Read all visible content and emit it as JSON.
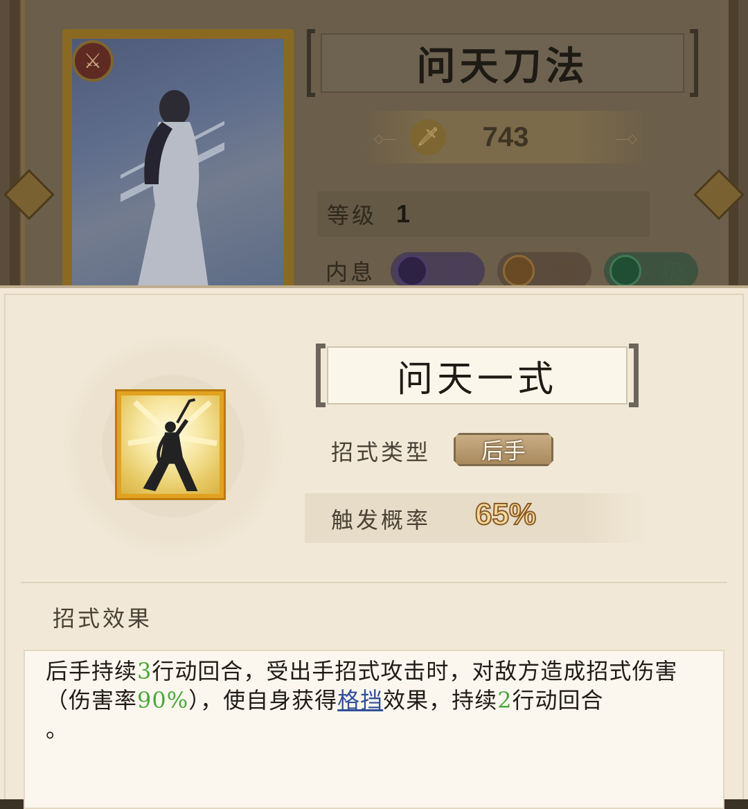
{
  "background_card": {
    "title": "问天刀法",
    "power": "743",
    "level_label": "等级",
    "level_value": "1",
    "neixi_label": "内息",
    "neixi": [
      {
        "text": "强",
        "color": "#5b3d8a",
        "icon": "moon-orb-icon"
      },
      {
        "text": "强",
        "color": "#8d6a34",
        "icon": "sun-orb-icon"
      },
      {
        "text": "极",
        "color": "#3f7a54",
        "icon": "jade-orb-icon"
      }
    ]
  },
  "skill": {
    "name": "问天一式",
    "type_label": "招式类型",
    "type_value": "后手",
    "trigger_label": "触发概率",
    "trigger_value": "65%",
    "effect_heading": "招式效果",
    "effect": {
      "p1": "后手持续",
      "n1": "3",
      "p2": "行动回合，受出手招式攻击时，对敌方造成招式伤害（伤害率",
      "n2": "90%",
      "p3": "），使自身获得",
      "keyword": "格挡",
      "p4": "效果，持续",
      "n3": "2",
      "p5": "行动回合",
      "p6": "。"
    }
  },
  "colors": {
    "highlight_number": "#4aa63c",
    "keyword_link": "#2f4f9a",
    "popup_bg": "#f1e8d7"
  }
}
